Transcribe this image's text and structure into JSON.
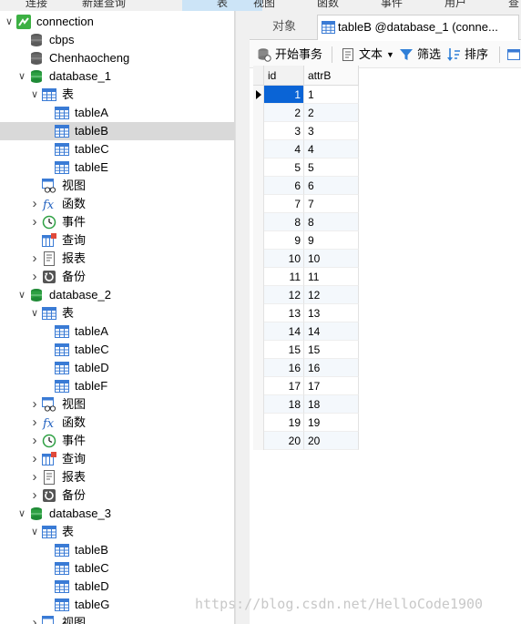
{
  "menubar": {
    "items": [
      "连接",
      "新建查询",
      "表",
      "视图",
      "函数",
      "事件",
      "用户",
      "查"
    ],
    "active": "表"
  },
  "tree": [
    {
      "depth": 0,
      "expand": "open",
      "icon": "connection",
      "label": "connection"
    },
    {
      "depth": 1,
      "expand": "none",
      "icon": "db-gray",
      "label": "cbps"
    },
    {
      "depth": 1,
      "expand": "none",
      "icon": "db-gray",
      "label": "Chenhaocheng"
    },
    {
      "depth": 1,
      "expand": "open",
      "icon": "db-green",
      "label": "database_1"
    },
    {
      "depth": 2,
      "expand": "open",
      "icon": "table",
      "label": "表"
    },
    {
      "depth": 3,
      "expand": "none",
      "icon": "table",
      "label": "tableA"
    },
    {
      "depth": 3,
      "expand": "none",
      "icon": "table",
      "label": "tableB",
      "selected": true
    },
    {
      "depth": 3,
      "expand": "none",
      "icon": "table",
      "label": "tableC"
    },
    {
      "depth": 3,
      "expand": "none",
      "icon": "table",
      "label": "tableE"
    },
    {
      "depth": 2,
      "expand": "none",
      "icon": "view",
      "label": "视图"
    },
    {
      "depth": 2,
      "expand": "closed",
      "icon": "function",
      "label": "函数"
    },
    {
      "depth": 2,
      "expand": "closed",
      "icon": "event",
      "label": "事件"
    },
    {
      "depth": 2,
      "expand": "none",
      "icon": "query",
      "label": "查询"
    },
    {
      "depth": 2,
      "expand": "closed",
      "icon": "report",
      "label": "报表"
    },
    {
      "depth": 2,
      "expand": "closed",
      "icon": "backup",
      "label": "备份"
    },
    {
      "depth": 1,
      "expand": "open",
      "icon": "db-green",
      "label": "database_2"
    },
    {
      "depth": 2,
      "expand": "open",
      "icon": "table",
      "label": "表"
    },
    {
      "depth": 3,
      "expand": "none",
      "icon": "table",
      "label": "tableA"
    },
    {
      "depth": 3,
      "expand": "none",
      "icon": "table",
      "label": "tableC"
    },
    {
      "depth": 3,
      "expand": "none",
      "icon": "table",
      "label": "tableD"
    },
    {
      "depth": 3,
      "expand": "none",
      "icon": "table",
      "label": "tableF"
    },
    {
      "depth": 2,
      "expand": "closed",
      "icon": "view",
      "label": "视图"
    },
    {
      "depth": 2,
      "expand": "closed",
      "icon": "function",
      "label": "函数"
    },
    {
      "depth": 2,
      "expand": "closed",
      "icon": "event",
      "label": "事件"
    },
    {
      "depth": 2,
      "expand": "closed",
      "icon": "query",
      "label": "查询"
    },
    {
      "depth": 2,
      "expand": "closed",
      "icon": "report",
      "label": "报表"
    },
    {
      "depth": 2,
      "expand": "closed",
      "icon": "backup",
      "label": "备份"
    },
    {
      "depth": 1,
      "expand": "open",
      "icon": "db-green",
      "label": "database_3"
    },
    {
      "depth": 2,
      "expand": "open",
      "icon": "table",
      "label": "表"
    },
    {
      "depth": 3,
      "expand": "none",
      "icon": "table",
      "label": "tableB"
    },
    {
      "depth": 3,
      "expand": "none",
      "icon": "table",
      "label": "tableC"
    },
    {
      "depth": 3,
      "expand": "none",
      "icon": "table",
      "label": "tableD"
    },
    {
      "depth": 3,
      "expand": "none",
      "icon": "table",
      "label": "tableG"
    },
    {
      "depth": 2,
      "expand": "closed",
      "icon": "view",
      "label": "视图"
    }
  ],
  "tabs": {
    "objects": "对象",
    "active": "tableB @database_1 (conne..."
  },
  "toolbar": {
    "begin_transaction": "开始事务",
    "text": "文本",
    "filter": "筛选",
    "sort": "排序"
  },
  "grid": {
    "columns": [
      "id",
      "attrB"
    ],
    "rows": [
      [
        "1",
        "1"
      ],
      [
        "2",
        "2"
      ],
      [
        "3",
        "3"
      ],
      [
        "4",
        "4"
      ],
      [
        "5",
        "5"
      ],
      [
        "6",
        "6"
      ],
      [
        "7",
        "7"
      ],
      [
        "8",
        "8"
      ],
      [
        "9",
        "9"
      ],
      [
        "10",
        "10"
      ],
      [
        "11",
        "11"
      ],
      [
        "12",
        "12"
      ],
      [
        "13",
        "13"
      ],
      [
        "14",
        "14"
      ],
      [
        "15",
        "15"
      ],
      [
        "16",
        "16"
      ],
      [
        "17",
        "17"
      ],
      [
        "18",
        "18"
      ],
      [
        "19",
        "19"
      ],
      [
        "20",
        "20"
      ]
    ],
    "current_row": 0
  },
  "watermark": "https://blog.csdn.net/HelloCode1900",
  "colors": {
    "selection_blue": "#0a64d6",
    "tree_selected": "#d9d9d9",
    "db_green": "#2ea043",
    "table_blue": "#3a7bd5"
  }
}
